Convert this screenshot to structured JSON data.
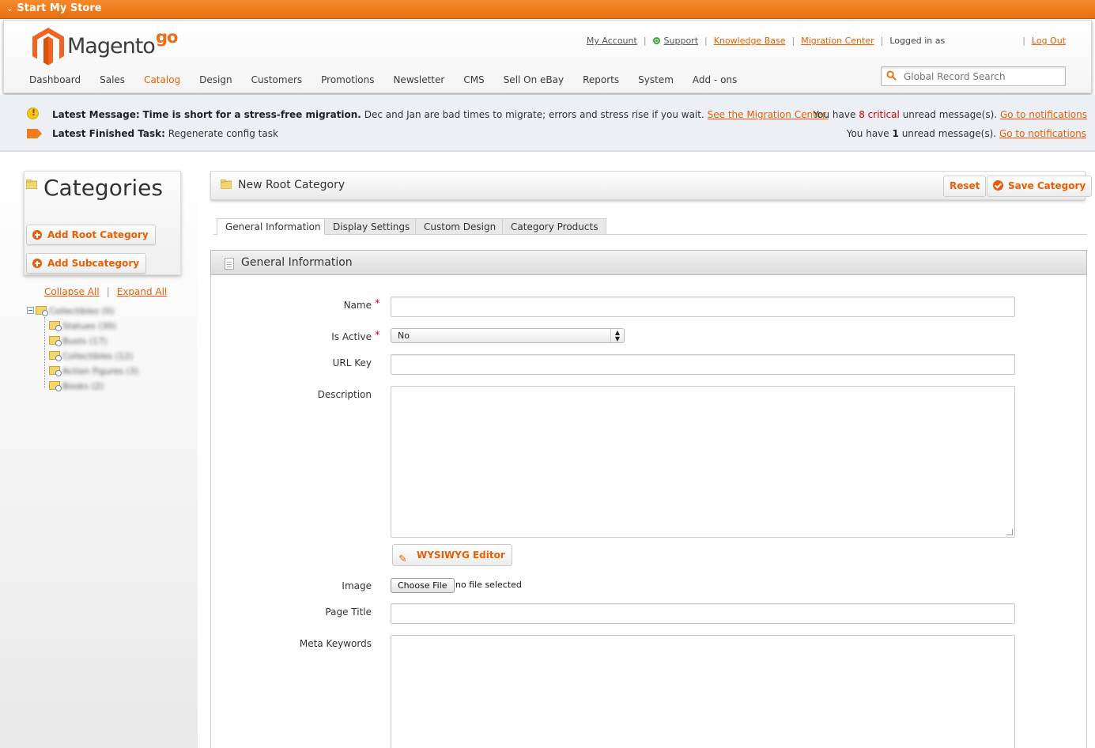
{
  "topbar": {
    "title": "Start My Store"
  },
  "header": {
    "logo_word": "Magento",
    "logo_go": "go",
    "links": {
      "my_account": "My Account",
      "support": "Support",
      "knowledge_base": "Knowledge Base",
      "migration_center": "Migration Center",
      "logged_in": "Logged in as",
      "logout": "Log Out"
    },
    "nav": [
      "Dashboard",
      "Sales",
      "Catalog",
      "Design",
      "Customers",
      "Promotions",
      "Newsletter",
      "CMS",
      "Sell On eBay",
      "Reports",
      "System",
      "Add - ons"
    ],
    "search_placeholder": "Global Record Search"
  },
  "messages": {
    "latest_label": "Latest Message:",
    "latest_bold": "Time is short for a stress-free migration.",
    "latest_text": "Dec and Jan are bad times to migrate; errors and stress rise if you wait.",
    "latest_link": "See the Migration Center.",
    "task_label": "Latest Finished Task:",
    "task_text": "Regenerate config task",
    "right1_prefix": "You have",
    "right1_count": "8 critical",
    "right1_suffix": "unread message(s).",
    "right1_link": "Go to notifications",
    "right2_prefix": "You have",
    "right2_count": "1",
    "right2_suffix": "unread message(s).",
    "right2_link": "Go to notifications"
  },
  "sidebar": {
    "title": "Categories",
    "add_root": "Add Root Category",
    "add_sub": "Add Subcategory",
    "collapse_all": "Collapse All",
    "expand_all": "Expand All",
    "tree": [
      "Collectibles (0)",
      "Statues (30)",
      "Busts (17)",
      "Collectibles (12)",
      "Action Figures (3)",
      "Books (2)"
    ]
  },
  "main": {
    "page_title": "New Root Category",
    "reset": "Reset",
    "save": "Save Category",
    "tabs": [
      "General Information",
      "Display Settings",
      "Custom Design",
      "Category Products"
    ],
    "section_title": "General Information",
    "fields": {
      "name_label": "Name",
      "is_active_label": "Is Active",
      "is_active_value": "No",
      "url_key_label": "URL Key",
      "description_label": "Description",
      "wysiwyg": "WYSIWYG Editor",
      "image_label": "Image",
      "choose_file": "Choose File",
      "no_file": "no file selected",
      "page_title_label": "Page Title",
      "meta_keywords_label": "Meta Keywords"
    }
  },
  "colors": {
    "accent": "#eb5e00",
    "topbar": "#f07d1b",
    "required": "#e00000"
  }
}
